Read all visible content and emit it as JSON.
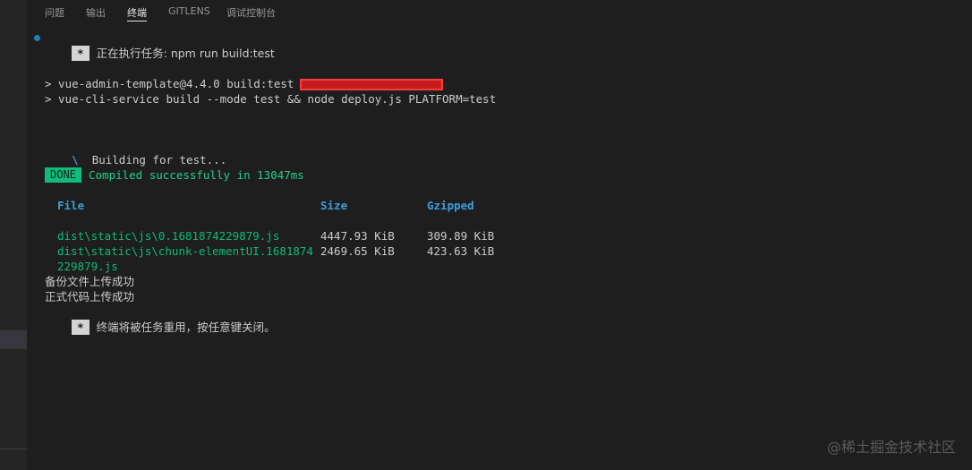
{
  "tabs": [
    {
      "label": "问题",
      "active": false
    },
    {
      "label": "输出",
      "active": false
    },
    {
      "label": "终端",
      "active": true
    },
    {
      "label": "GITLENS",
      "active": false
    },
    {
      "label": "调试控制台",
      "active": false
    }
  ],
  "terminal": {
    "star": "*",
    "task_line": "正在执行任务: npm run build:test",
    "cmd1": "> vue-admin-template@4.4.0 build:test D:\\",
    "cmd2": "> vue-cli-service build --mode test && node deploy.js PLATFORM=test",
    "spinner": "\\",
    "building": "Building for test...",
    "done_badge": "DONE",
    "compiled": "Compiled successfully in 13047ms",
    "headers": {
      "file": "File",
      "size": "Size",
      "gzipped": "Gzipped"
    },
    "files": [
      {
        "file": "dist\\static\\js\\0.1681874229879.js",
        "size": "4447.93 KiB",
        "gzipped": "309.89 KiB"
      },
      {
        "file": "dist\\static\\js\\chunk-elementUI.1681874",
        "file_cont": "229879.js",
        "size": "2469.65 KiB",
        "gzipped": "423.63 KiB"
      }
    ],
    "backup_msg": "备份文件上传成功",
    "prod_msg": "正式代码上传成功",
    "reuse_msg": "终端将被任务重用，按任意键关闭。"
  },
  "watermark": "@稀土掘金技术社区",
  "colors": {
    "background": "#1e1e1e",
    "green": "#23d18b",
    "blue": "#3b9fde",
    "badge": "#0dbc79"
  }
}
